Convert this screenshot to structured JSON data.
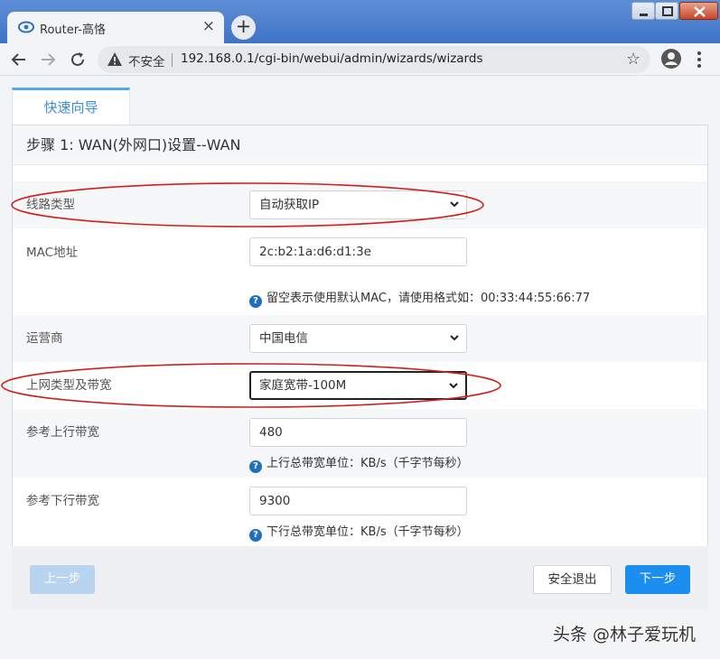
{
  "browser": {
    "tab_title": "Router-高恪",
    "tab_close": "×",
    "new_tab": "+",
    "security_label": "不安全",
    "url": "192.168.0.1/cgi-bin/webui/admin/wizards/wizards",
    "bookmark_star": "☆"
  },
  "wizard": {
    "tab_label": "快速向导",
    "step_title": "步骤 1: WAN(外网口)设置--WAN",
    "fields": {
      "line_type": {
        "label": "线路类型",
        "value": "自动获取IP"
      },
      "mac": {
        "label": "MAC地址",
        "value": "2c:b2:1a:d6:d1:3e",
        "hint": "留空表示使用默认MAC，请使用格式如：00:33:44:55:66:77"
      },
      "isp": {
        "label": "运营商",
        "value": "中国电信"
      },
      "bandwidth_type": {
        "label": "上网类型及带宽",
        "value": "家庭宽带-100M"
      },
      "upload": {
        "label": "参考上行带宽",
        "value": "480",
        "hint": "上行总带宽单位：KB/s（千字节每秒）"
      },
      "download": {
        "label": "参考下行带宽",
        "value": "9300",
        "hint": "下行总带宽单位：KB/s（千字节每秒）"
      }
    },
    "hint_icon": "?",
    "buttons": {
      "prev": "上一步",
      "exit": "安全退出",
      "next": "下一步"
    }
  },
  "watermark": "头条 @林子爱玩机",
  "colors": {
    "primary": "#1c8ef0",
    "disabled": "#b9d4ef",
    "annotation": "#d0201c",
    "tab_accent": "#58a7e6"
  },
  "icons": [
    "router-favicon",
    "close-icon",
    "plus-icon",
    "back-arrow-icon",
    "forward-arrow-icon",
    "reload-icon",
    "warning-icon",
    "star-icon",
    "account-icon",
    "more-menu-icon",
    "help-icon",
    "chevron-down-icon"
  ]
}
